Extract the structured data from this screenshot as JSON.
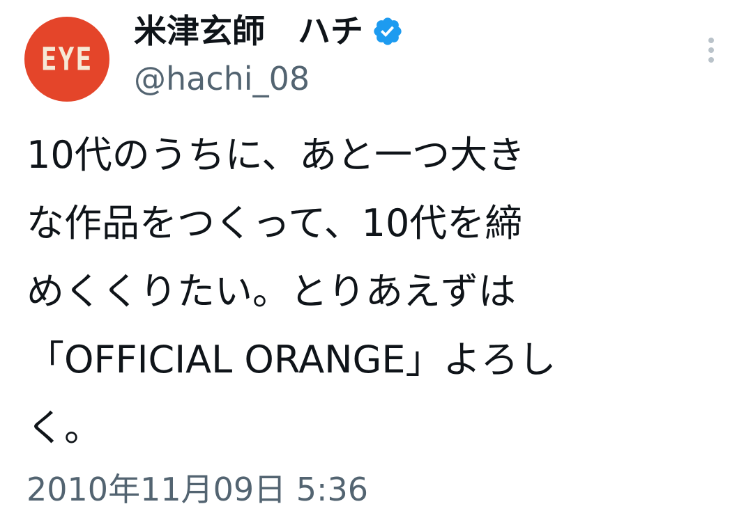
{
  "author": {
    "avatar_text": "EYE",
    "display_name": "米津玄師　ハチ",
    "handle": "@hachi_08",
    "verified_icon": "verified-badge-icon"
  },
  "menu": {
    "icon": "more-vertical-icon"
  },
  "tweet": {
    "lines": [
      "10代のうちに、あと一つ大き",
      "な作品をつくって、10代を締",
      "めくくりたい。とりあえずは",
      "「OFFICIAL ORANGE」よろし",
      "く。"
    ],
    "timestamp": "2010年11月09日 5:36"
  },
  "colors": {
    "avatar_bg": "#e4452a",
    "verified": "#1d9bf0",
    "text_primary": "#0f1419",
    "text_secondary": "#536471"
  }
}
